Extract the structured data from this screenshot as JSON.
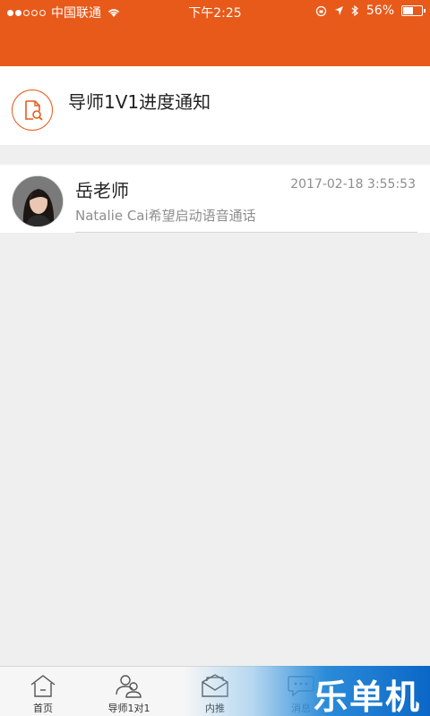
{
  "status_bar": {
    "carrier": "中国联通",
    "time": "下午2:25",
    "battery": "56%",
    "battery_level": 0.56
  },
  "notification": {
    "title": "导师1V1进度通知"
  },
  "messages": [
    {
      "name": "岳老师",
      "time": "2017-02-18 3:55:53",
      "preview": "Natalie Cai希望启动语音通话"
    }
  ],
  "tabs": [
    {
      "label": "首页"
    },
    {
      "label": "导师1对1"
    },
    {
      "label": "内推"
    },
    {
      "label": "消息"
    }
  ],
  "watermark": "乐单机",
  "colors": {
    "brand_orange": "#e85a1a",
    "background": "#efefef"
  }
}
